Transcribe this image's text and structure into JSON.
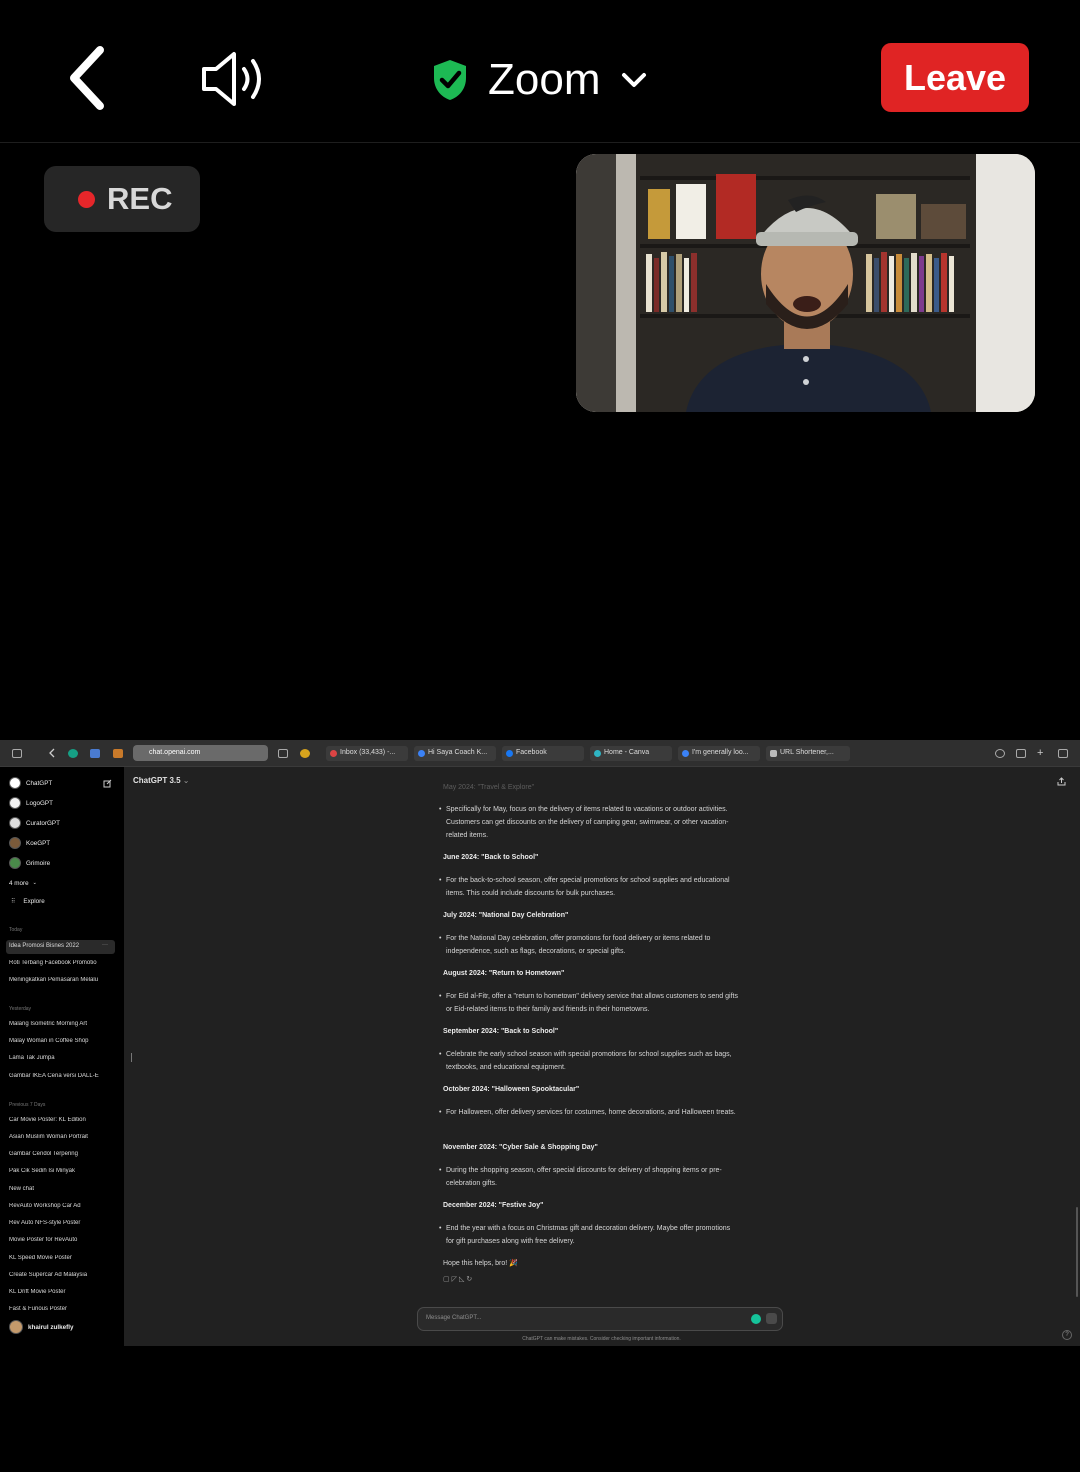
{
  "topbar": {
    "title": "Zoom",
    "leave_label": "Leave",
    "back_icon": "chevron-left-icon",
    "speaker_icon": "speaker-icon",
    "shield_color": "#1db954",
    "leave_color": "#e02424"
  },
  "rec": {
    "label": "REC"
  },
  "browser": {
    "url": "chat.openai.com",
    "tabs": [
      "Inbox (33,433) -...",
      "Hi Saya Coach K...",
      "Facebook",
      "Home - Canva",
      "I'm generally loo...",
      "URL Shortener,..."
    ]
  },
  "sidebar": {
    "gpts": [
      "ChatGPT",
      "LogoGPT",
      "CuratorGPT",
      "KoeGPT",
      "Grimoire"
    ],
    "more": "4 more",
    "explore": "Explore",
    "sections": {
      "today": "Today",
      "yesterday": "Yesterday",
      "prev7": "Previous 7 Days"
    },
    "today": [
      "Idea Promosi Bisnes 2022",
      "Roti Terbang Facebook Promotio",
      "Meningkatkan Pemasaran Melalu"
    ],
    "yesterday": [
      "Malang Isometric Morning Art",
      "Malay Woman in Coffee Shop",
      "Lama Tak Jumpa",
      "Gambar IKEA Ceria versi DALL-E"
    ],
    "prev7": [
      "Car Movie Poster: KL Edition",
      "Asian Muslim Woman Portrait",
      "Gambar Cendol Terpering",
      "Pak Cik Sedih Isi Minyak",
      "New chat",
      "RevAuto Workshop Car Ad",
      "Rev Auto NFS-style Poster",
      "Movie Poster for RevAuto",
      "KL Speed Movie Poster",
      "Create Supercar Ad Malaysia",
      "KL Drift Movie Poster",
      "Fast & Furious Poster"
    ],
    "user": "khairul zulkefly"
  },
  "main": {
    "model": "ChatGPT 3.5",
    "faded_head": "May 2024: \"Travel & Explore\"",
    "intro_bullet": "Specifically for May, focus on the delivery of items related to vacations or outdoor activities. Customers can get discounts on the delivery of camping gear, swimwear, or other vacation-related items.",
    "sections": [
      {
        "head": "June 2024: \"Back to School\"",
        "text": "For the back-to-school season, offer special promotions for school supplies and educational items. This could include discounts for bulk purchases."
      },
      {
        "head": "July 2024: \"National Day Celebration\"",
        "text": "For the National Day celebration, offer promotions for food delivery or items related to independence, such as flags, decorations, or special gifts."
      },
      {
        "head": "August 2024: \"Return to Hometown\"",
        "text": "For Eid al-Fitr, offer a \"return to hometown\" delivery service that allows customers to send gifts or Eid-related items to their family and friends in their hometowns."
      },
      {
        "head": "September 2024: \"Back to School\"",
        "text": "Celebrate the early school season with special promotions for school supplies such as bags, textbooks, and educational equipment."
      },
      {
        "head": "October 2024: \"Halloween Spooktacular\"",
        "text": "For Halloween, offer delivery services for costumes, home decorations, and Halloween treats."
      },
      {
        "head": "November 2024: \"Cyber Sale & Shopping Day\"",
        "text": "During the shopping season, offer special discounts for delivery of shopping items or pre-celebration gifts."
      },
      {
        "head": "December 2024: \"Festive Joy\"",
        "text": "End the year with a focus on Christmas gift and decoration delivery. Maybe offer promotions for gift purchases along with free delivery."
      }
    ],
    "closing": "Hope this helps, bro! 🎉",
    "input_placeholder": "Message ChatGPT...",
    "disclaimer": "ChatGPT can make mistakes. Consider checking important information."
  }
}
